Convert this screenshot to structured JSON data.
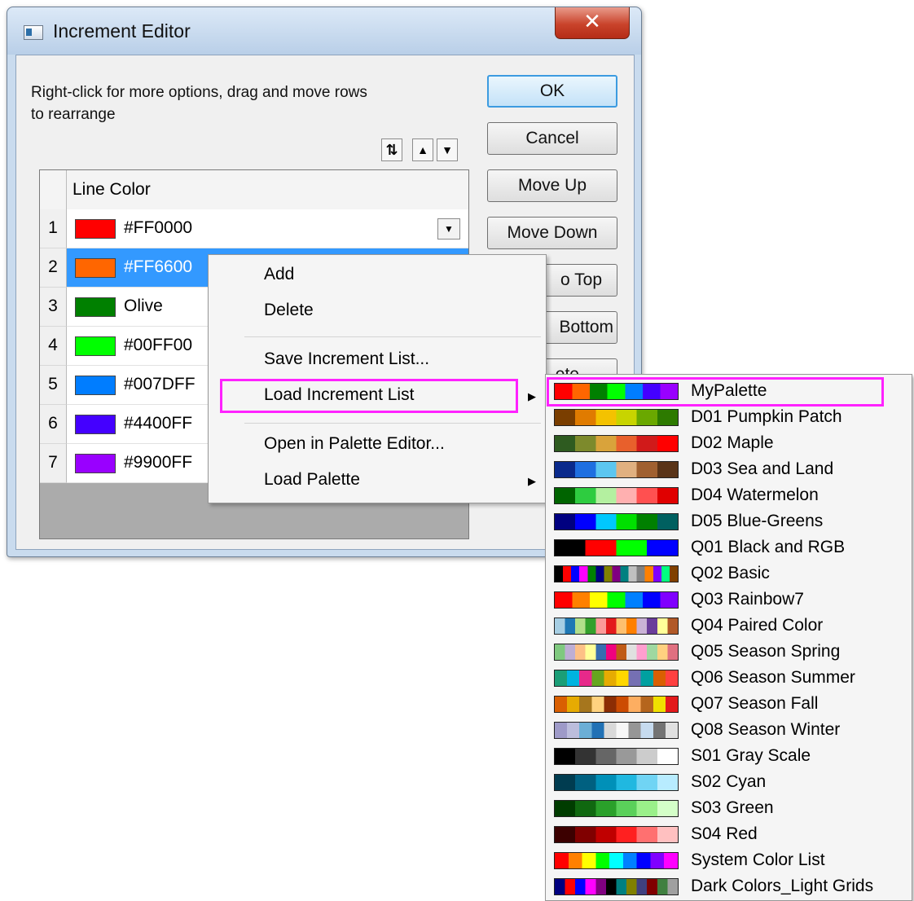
{
  "window": {
    "title": "Increment Editor",
    "close_glyph": "✕"
  },
  "hint": "Right-click for more options, drag and move rows to  rearrange",
  "toolbar": {
    "sort_glyph": "⇅",
    "up_glyph": "▲",
    "down_glyph": "▼"
  },
  "buttons": {
    "ok": "OK",
    "cancel": "Cancel",
    "move_up": "Move Up",
    "move_down": "Move Down",
    "to_top": "o Top",
    "to_bottom": "Bottom",
    "delete": "ete"
  },
  "grid": {
    "header": "Line Color",
    "rows": [
      {
        "num": "1",
        "text": "#FF0000",
        "color": "#FF0000"
      },
      {
        "num": "2",
        "text": "#FF6600",
        "color": "#FF6600"
      },
      {
        "num": "3",
        "text": "Olive",
        "color": "#008000"
      },
      {
        "num": "4",
        "text": "#00FF00",
        "color": "#00FF00"
      },
      {
        "num": "5",
        "text": "#007DFF",
        "color": "#007DFF"
      },
      {
        "num": "6",
        "text": "#4400FF",
        "color": "#4400FF"
      },
      {
        "num": "7",
        "text": "#9900FF",
        "color": "#9900FF"
      }
    ],
    "selected_row": 2
  },
  "context_menu": {
    "add": "Add",
    "delete": "Delete",
    "save": "Save Increment List...",
    "load": "Load Increment List",
    "open_palette_editor": "Open in Palette Editor...",
    "load_palette": "Load Palette",
    "arrow_glyph": "▶"
  },
  "palettes": [
    {
      "label": "MyPalette",
      "colors": [
        "#FF0000",
        "#FF6600",
        "#008000",
        "#00FF00",
        "#007DFF",
        "#4400FF",
        "#9900FF"
      ]
    },
    {
      "label": "D01 Pumpkin Patch",
      "colors": [
        "#7a3e00",
        "#e07b00",
        "#f4c200",
        "#c8d400",
        "#6aa800",
        "#2d7a00"
      ]
    },
    {
      "label": "D02 Maple",
      "colors": [
        "#2e5b20",
        "#7d8a2c",
        "#d9a33b",
        "#e8602c",
        "#d11a1a",
        "#ff0000"
      ]
    },
    {
      "label": "D03 Sea and Land",
      "colors": [
        "#0a2a8c",
        "#1f6fe0",
        "#5cc6f0",
        "#e0b080",
        "#a06030",
        "#5a3418"
      ]
    },
    {
      "label": "D04 Watermelon",
      "colors": [
        "#006400",
        "#2ecc40",
        "#b4f0a0",
        "#ffb0b0",
        "#ff5050",
        "#e00000"
      ]
    },
    {
      "label": "D05 Blue-Greens",
      "colors": [
        "#000080",
        "#0000ff",
        "#00c8ff",
        "#00e000",
        "#008000",
        "#006060"
      ]
    },
    {
      "label": "Q01 Black and RGB",
      "colors": [
        "#000000",
        "#ff0000",
        "#00ff00",
        "#0000ff"
      ]
    },
    {
      "label": "Q02 Basic",
      "colors": [
        "#000000",
        "#ff0000",
        "#0000ff",
        "#ff00ff",
        "#008000",
        "#000080",
        "#808000",
        "#800080",
        "#008080",
        "#c0c0c0",
        "#808080",
        "#ff8000",
        "#8000ff",
        "#00ff80",
        "#804000"
      ]
    },
    {
      "label": "Q03 Rainbow7",
      "colors": [
        "#ff0000",
        "#ff8000",
        "#ffff00",
        "#00ff00",
        "#0080ff",
        "#0000ff",
        "#8000ff"
      ]
    },
    {
      "label": "Q04 Paired Color",
      "colors": [
        "#a6cee3",
        "#1f78b4",
        "#b2df8a",
        "#33a02c",
        "#fb9a99",
        "#e31a1c",
        "#fdbf6f",
        "#ff7f00",
        "#cab2d6",
        "#6a3d9a",
        "#ffff99",
        "#b15928"
      ]
    },
    {
      "label": "Q05 Season Spring",
      "colors": [
        "#7fc97f",
        "#beaed4",
        "#fdc086",
        "#ffff99",
        "#386cb0",
        "#f0027f",
        "#bf5b17",
        "#e0e0e0",
        "#ff9ecf",
        "#9fd8a0",
        "#ffd080",
        "#e07080"
      ]
    },
    {
      "label": "Q06 Season Summer",
      "colors": [
        "#1b9e77",
        "#00b4e0",
        "#e7298a",
        "#66a61e",
        "#e6ab02",
        "#ffd700",
        "#7570b3",
        "#00a0a0",
        "#d95f02",
        "#ff4040"
      ]
    },
    {
      "label": "Q07 Season Fall",
      "colors": [
        "#d95f02",
        "#e6ab02",
        "#a6761d",
        "#ffd27f",
        "#8c2d04",
        "#cc4c02",
        "#fdae61",
        "#b5651d",
        "#f0e000",
        "#e31a1c"
      ]
    },
    {
      "label": "Q08 Season Winter",
      "colors": [
        "#9e9ac8",
        "#bcbddc",
        "#6baed6",
        "#2171b5",
        "#d9d9d9",
        "#f7f7f7",
        "#969696",
        "#c6dbef",
        "#737373",
        "#e0e0e0"
      ]
    },
    {
      "label": "S01 Gray Scale",
      "colors": [
        "#000000",
        "#333333",
        "#666666",
        "#999999",
        "#cccccc",
        "#ffffff"
      ]
    },
    {
      "label": "S02 Cyan",
      "colors": [
        "#003c50",
        "#006080",
        "#0090b8",
        "#20b8e0",
        "#70d4f4",
        "#b8ecff"
      ]
    },
    {
      "label": "S03 Green",
      "colors": [
        "#003c00",
        "#106810",
        "#2aa02a",
        "#5ad05a",
        "#9af08a",
        "#d4ffc8"
      ]
    },
    {
      "label": "S04 Red",
      "colors": [
        "#3c0000",
        "#800000",
        "#c00000",
        "#ff2020",
        "#ff7070",
        "#ffc0c0"
      ]
    },
    {
      "label": "System Color List",
      "colors": [
        "#ff0000",
        "#ff8000",
        "#ffff00",
        "#00ff00",
        "#00ffff",
        "#0080ff",
        "#0000ff",
        "#8000ff",
        "#ff00ff"
      ]
    },
    {
      "label": "Dark Colors_Light Grids",
      "colors": [
        "#000080",
        "#ff0000",
        "#0000ff",
        "#ff00ff",
        "#800080",
        "#000000",
        "#008080",
        "#808000",
        "#404080",
        "#800000",
        "#408040",
        "#a0a0a0"
      ]
    }
  ]
}
